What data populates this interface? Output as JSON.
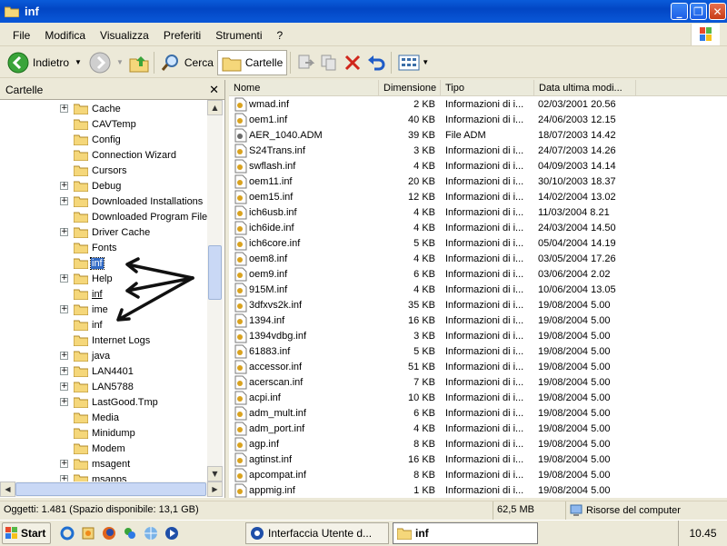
{
  "window": {
    "title": "inf"
  },
  "menu": [
    "File",
    "Modifica",
    "Visualizza",
    "Preferiti",
    "Strumenti",
    "?"
  ],
  "toolbar": {
    "back_label": "Indietro",
    "search_label": "Cerca",
    "folders_label": "Cartelle"
  },
  "folders_pane": {
    "title": "Cartelle",
    "items": [
      {
        "label": "Cache",
        "expander": "+"
      },
      {
        "label": "CAVTemp",
        "expander": ""
      },
      {
        "label": "Config",
        "expander": ""
      },
      {
        "label": "Connection Wizard",
        "expander": ""
      },
      {
        "label": "Cursors",
        "expander": ""
      },
      {
        "label": "Debug",
        "expander": "+"
      },
      {
        "label": "Downloaded Installations",
        "expander": "+"
      },
      {
        "label": "Downloaded Program Files",
        "expander": ""
      },
      {
        "label": "Driver Cache",
        "expander": "+"
      },
      {
        "label": "Fonts",
        "expander": ""
      },
      {
        "label": "inf",
        "expander": ""
      },
      {
        "label": "Help",
        "expander": "+"
      },
      {
        "label": "inf",
        "expander": ""
      },
      {
        "label": "ime",
        "expander": "+"
      },
      {
        "label": "inf",
        "expander": ""
      },
      {
        "label": "Internet Logs",
        "expander": ""
      },
      {
        "label": "java",
        "expander": "+"
      },
      {
        "label": "LAN4401",
        "expander": "+"
      },
      {
        "label": "LAN5788",
        "expander": "+"
      },
      {
        "label": "LastGood.Tmp",
        "expander": "+"
      },
      {
        "label": "Media",
        "expander": ""
      },
      {
        "label": "Minidump",
        "expander": ""
      },
      {
        "label": "Modem",
        "expander": ""
      },
      {
        "label": "msagent",
        "expander": "+"
      },
      {
        "label": "msapps",
        "expander": "+"
      }
    ]
  },
  "columns": [
    "Nome",
    "Dimensione",
    "Tipo",
    "Data ultima modi..."
  ],
  "files": [
    [
      "wmad.inf",
      "2 KB",
      "Informazioni di i...",
      "02/03/2001 20.56"
    ],
    [
      "oem1.inf",
      "40 KB",
      "Informazioni di i...",
      "24/06/2003 12.15"
    ],
    [
      "AER_1040.ADM",
      "39 KB",
      "File ADM",
      "18/07/2003 14.42"
    ],
    [
      "S24Trans.inf",
      "3 KB",
      "Informazioni di i...",
      "24/07/2003 14.26"
    ],
    [
      "swflash.inf",
      "4 KB",
      "Informazioni di i...",
      "04/09/2003 14.14"
    ],
    [
      "oem11.inf",
      "20 KB",
      "Informazioni di i...",
      "30/10/2003 18.37"
    ],
    [
      "oem15.inf",
      "12 KB",
      "Informazioni di i...",
      "14/02/2004 13.02"
    ],
    [
      "ich6usb.inf",
      "4 KB",
      "Informazioni di i...",
      "11/03/2004 8.21"
    ],
    [
      "ich6ide.inf",
      "4 KB",
      "Informazioni di i...",
      "24/03/2004 14.50"
    ],
    [
      "ich6core.inf",
      "5 KB",
      "Informazioni di i...",
      "05/04/2004 14.19"
    ],
    [
      "oem8.inf",
      "4 KB",
      "Informazioni di i...",
      "03/05/2004 17.26"
    ],
    [
      "oem9.inf",
      "6 KB",
      "Informazioni di i...",
      "03/06/2004 2.02"
    ],
    [
      "915M.inf",
      "4 KB",
      "Informazioni di i...",
      "10/06/2004 13.05"
    ],
    [
      "3dfxvs2k.inf",
      "35 KB",
      "Informazioni di i...",
      "19/08/2004 5.00"
    ],
    [
      "1394.inf",
      "16 KB",
      "Informazioni di i...",
      "19/08/2004 5.00"
    ],
    [
      "1394vdbg.inf",
      "3 KB",
      "Informazioni di i...",
      "19/08/2004 5.00"
    ],
    [
      "61883.inf",
      "5 KB",
      "Informazioni di i...",
      "19/08/2004 5.00"
    ],
    [
      "accessor.inf",
      "51 KB",
      "Informazioni di i...",
      "19/08/2004 5.00"
    ],
    [
      "acerscan.inf",
      "7 KB",
      "Informazioni di i...",
      "19/08/2004 5.00"
    ],
    [
      "acpi.inf",
      "10 KB",
      "Informazioni di i...",
      "19/08/2004 5.00"
    ],
    [
      "adm_mult.inf",
      "6 KB",
      "Informazioni di i...",
      "19/08/2004 5.00"
    ],
    [
      "adm_port.inf",
      "4 KB",
      "Informazioni di i...",
      "19/08/2004 5.00"
    ],
    [
      "agp.inf",
      "8 KB",
      "Informazioni di i...",
      "19/08/2004 5.00"
    ],
    [
      "agtinst.inf",
      "16 KB",
      "Informazioni di i...",
      "19/08/2004 5.00"
    ],
    [
      "apcompat.inf",
      "8 KB",
      "Informazioni di i...",
      "19/08/2004 5.00"
    ],
    [
      "appmig.inf",
      "1 KB",
      "Informazioni di i...",
      "19/08/2004 5.00"
    ]
  ],
  "status": {
    "objects": "Oggetti: 1.481 (Spazio disponibile: 13,1 GB)",
    "size": "62,5 MB",
    "location": "Risorse del computer"
  },
  "taskbar": {
    "start_label": "Start",
    "task1": "Interfaccia Utente d...",
    "task2": "inf",
    "clock": "10.45"
  },
  "colors": {
    "title_bar": "#0a5bd9",
    "selection": "#316ac5",
    "folder": "#f5d77a"
  }
}
